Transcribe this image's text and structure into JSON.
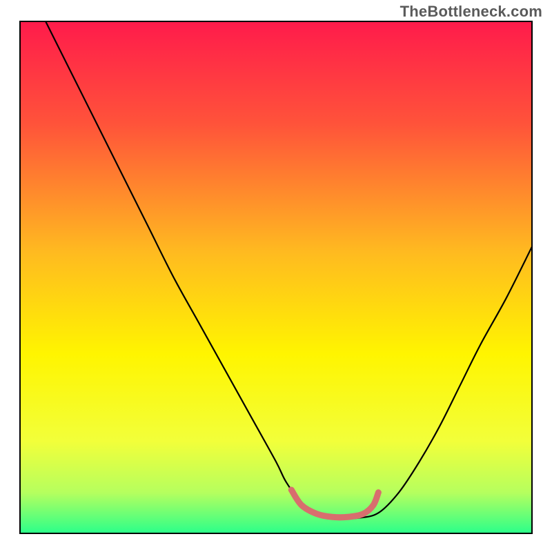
{
  "watermark": "TheBottleneck.com",
  "chart_data": {
    "type": "line",
    "title": "",
    "xlabel": "",
    "ylabel": "",
    "xlim": [
      0,
      100
    ],
    "ylim": [
      0,
      100
    ],
    "grid": false,
    "legend": false,
    "axes_visible": false,
    "background_gradient": {
      "type": "vertical",
      "stops": [
        {
          "pos": 0.0,
          "color": "#ff1b4b"
        },
        {
          "pos": 0.2,
          "color": "#ff533a"
        },
        {
          "pos": 0.45,
          "color": "#ffba20"
        },
        {
          "pos": 0.65,
          "color": "#fff500"
        },
        {
          "pos": 0.82,
          "color": "#f2ff3a"
        },
        {
          "pos": 0.92,
          "color": "#b6ff5e"
        },
        {
          "pos": 1.0,
          "color": "#2bff8a"
        }
      ]
    },
    "series": [
      {
        "name": "bottleneck-curve",
        "stroke": "#000000",
        "stroke_width": 2.2,
        "x": [
          5,
          10,
          15,
          20,
          25,
          30,
          35,
          40,
          45,
          50,
          52,
          55,
          58,
          62,
          66,
          70,
          74,
          78,
          82,
          86,
          90,
          95,
          100
        ],
        "y": [
          100,
          90,
          80,
          70,
          60,
          50,
          41,
          32,
          23,
          14,
          10,
          6,
          4,
          3,
          3,
          4,
          8,
          14,
          21,
          29,
          37,
          46,
          56
        ]
      },
      {
        "name": "optimal-band",
        "stroke": "#d86e6e",
        "stroke_width": 9,
        "linecap": "round",
        "x": [
          53,
          55,
          58,
          61,
          64,
          67,
          69,
          70
        ],
        "y": [
          8.5,
          5.5,
          3.8,
          3.2,
          3.2,
          3.8,
          5.5,
          8.0
        ]
      }
    ]
  }
}
